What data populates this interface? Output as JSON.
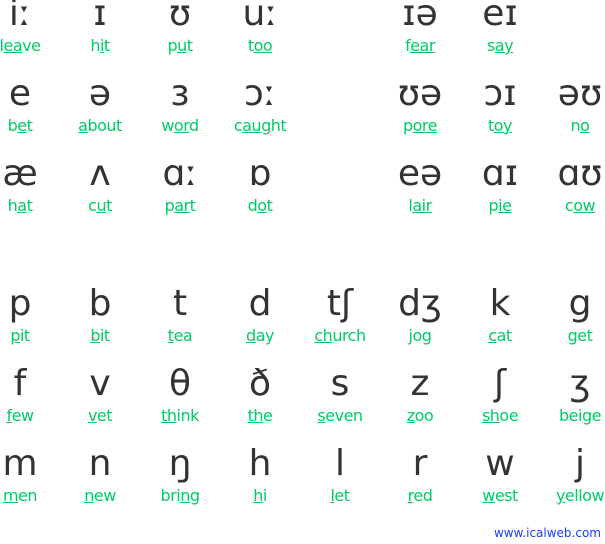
{
  "vowels": [
    [
      {
        "s": "iː",
        "pre": "l",
        "u": "ea",
        "post": "ve"
      },
      {
        "s": "ɪ",
        "pre": "h",
        "u": "i",
        "post": "t"
      },
      {
        "s": "ʊ",
        "pre": "p",
        "u": "u",
        "post": "t"
      },
      {
        "s": "uː",
        "pre": "t",
        "u": "oo",
        "post": ""
      },
      null,
      {
        "s": "ɪə",
        "pre": "f",
        "u": "ear",
        "post": ""
      },
      {
        "s": "eɪ",
        "pre": "s",
        "u": "ay",
        "post": ""
      },
      null
    ],
    [
      {
        "s": "e",
        "pre": "b",
        "u": "e",
        "post": "t"
      },
      {
        "s": "ə",
        "pre": "",
        "u": "a",
        "post": "bout"
      },
      {
        "s": "ɜ",
        "pre": "w",
        "u": "or",
        "post": "d"
      },
      {
        "s": "ɔː",
        "pre": "c",
        "u": "aug",
        "post": "ht"
      },
      null,
      {
        "s": "ʊə",
        "pre": "p",
        "u": "ore",
        "post": ""
      },
      {
        "s": "ɔɪ",
        "pre": "t",
        "u": "oy",
        "post": ""
      },
      {
        "s": "əʊ",
        "pre": "n",
        "u": "o",
        "post": ""
      }
    ],
    [
      {
        "s": "æ",
        "pre": "h",
        "u": "a",
        "post": "t"
      },
      {
        "s": "ʌ",
        "pre": "c",
        "u": "u",
        "post": "t"
      },
      {
        "s": "ɑː",
        "pre": "p",
        "u": "ar",
        "post": "t"
      },
      {
        "s": "ɒ",
        "pre": "d",
        "u": "o",
        "post": "t"
      },
      null,
      {
        "s": "eə",
        "pre": "l",
        "u": "air",
        "post": ""
      },
      {
        "s": "ɑɪ",
        "pre": "p",
        "u": "ie",
        "post": ""
      },
      {
        "s": "ɑʊ",
        "pre": "c",
        "u": "ow",
        "post": ""
      }
    ]
  ],
  "consonants": [
    [
      {
        "s": "p",
        "pre": "",
        "u": "p",
        "post": "it"
      },
      {
        "s": "b",
        "pre": "",
        "u": "b",
        "post": "it"
      },
      {
        "s": "t",
        "pre": "",
        "u": "t",
        "post": "ea"
      },
      {
        "s": "d",
        "pre": "",
        "u": "d",
        "post": "ay"
      },
      {
        "s": "tʃ",
        "pre": "",
        "u": "ch",
        "post": "urch"
      },
      {
        "s": "dʒ",
        "pre": "",
        "u": "j",
        "post": "og"
      },
      {
        "s": "k",
        "pre": "",
        "u": "c",
        "post": "at"
      },
      {
        "s": "g",
        "pre": "",
        "u": "g",
        "post": "et"
      }
    ],
    [
      {
        "s": "f",
        "pre": "",
        "u": "f",
        "post": "ew"
      },
      {
        "s": "v",
        "pre": "",
        "u": "v",
        "post": "et"
      },
      {
        "s": "θ",
        "pre": "",
        "u": "th",
        "post": "ink"
      },
      {
        "s": "ð",
        "pre": "",
        "u": "th",
        "post": "e"
      },
      {
        "s": "s",
        "pre": "",
        "u": "s",
        "post": "even"
      },
      {
        "s": "z",
        "pre": "",
        "u": "z",
        "post": "oo"
      },
      {
        "s": "ʃ",
        "pre": "",
        "u": "sh",
        "post": "oe"
      },
      {
        "s": "ʒ",
        "pre": "bei",
        "u": "g",
        "post": "e"
      }
    ],
    [
      {
        "s": "m",
        "pre": "",
        "u": "m",
        "post": "en"
      },
      {
        "s": "n",
        "pre": "",
        "u": "n",
        "post": "ew"
      },
      {
        "s": "ŋ",
        "pre": "bri",
        "u": "ng",
        "post": ""
      },
      {
        "s": "h",
        "pre": "",
        "u": "h",
        "post": "i"
      },
      {
        "s": "l",
        "pre": "",
        "u": "l",
        "post": "et"
      },
      {
        "s": "r",
        "pre": "",
        "u": "r",
        "post": "ed"
      },
      {
        "s": "w",
        "pre": "",
        "u": "w",
        "post": "est"
      },
      {
        "s": "j",
        "pre": "",
        "u": "y",
        "post": "ellow"
      }
    ]
  ],
  "footer": "www.icalweb.com",
  "colors": {
    "symbol": "#333333",
    "word": "#00cc66",
    "footer": "#1a3cff"
  }
}
